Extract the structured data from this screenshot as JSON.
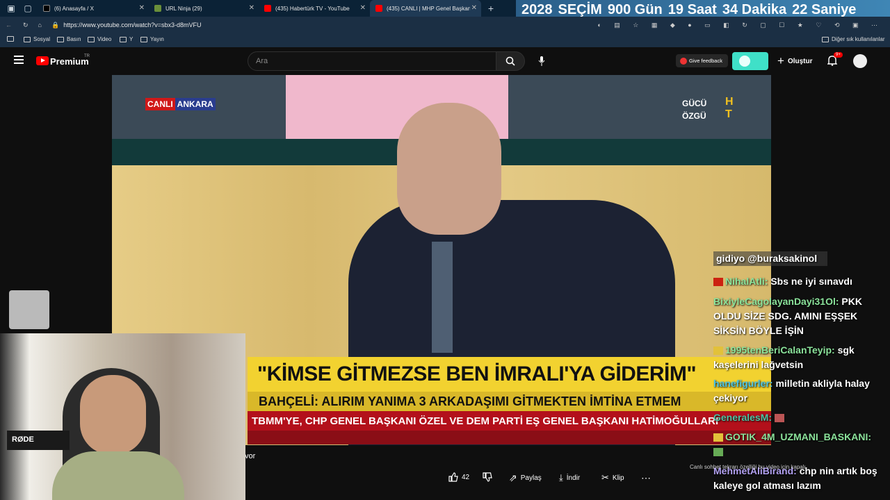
{
  "browser": {
    "tabs": [
      {
        "title": "(6) Anasayfa / X"
      },
      {
        "title": "URL Ninja (29)"
      },
      {
        "title": "(435) Habertürk TV - YouTube"
      },
      {
        "title": "(435) CANLI | MHP Genel Başkan..."
      }
    ],
    "url": "https://www.youtube.com/watch?v=sbx3-d8mVFU",
    "bookmarks": [
      "Sosyal",
      "Basın",
      "Video",
      "Y",
      "Yayın"
    ],
    "other_bookmarks": "Diğer sık kullanılanlar"
  },
  "countdown": {
    "parts": [
      "2028",
      "SEÇİM",
      "900 Gün",
      "19 Saat",
      "34 Dakika",
      "22 Saniye"
    ]
  },
  "youtube": {
    "logo_text": "Premium",
    "logo_sup": "TR",
    "search_placeholder": "Ara",
    "feedback_label": "Give feedback",
    "create_label": "Oluştur",
    "notification_count": "9+"
  },
  "video": {
    "live_label": "CANLI",
    "city_label": "ANKARA",
    "corner_logo_1": "GÜCÜ",
    "corner_logo_2": "ÖZGÜ",
    "corner_logo_ht": "HT",
    "headline": "\"KİMSE GİTMEZSE BEN İMRALI'YA GİDERİM\"",
    "subline": "BAHÇELİ: ALIRIM YANIMA 3 ARKADAŞIMI GİTMEKTEN İMTİNA ETMEM",
    "ticker": "TBMM'YE, CHP GENEL BAŞKANI ÖZEL VE DEM PARTİ EŞ GENEL BAŞKANI HATİMOĞULLARI",
    "overlay_fragment": "vor"
  },
  "actions": {
    "like_count": "42",
    "share": "Paylaş",
    "download": "İndir",
    "clip": "Klip",
    "notice": "Canlı sohbet tekrarı özelliği bu video için kapalı"
  },
  "chat": [
    {
      "user": "",
      "text": "gidiyo @buraksakinol"
    },
    {
      "user": "NihalAtli:",
      "text": "Sbs ne iyi sınavdı"
    },
    {
      "user": "BixiyleCagolayanDayi31Ol:",
      "text": "PKK OLDU SİZE SDG. AMINI EŞŞEK SİKSİN BÖYLE İŞİN"
    },
    {
      "user": "1995tenBeriCalanTeyip:",
      "text": "sgk kaşelerini lağvetsin"
    },
    {
      "user": "hanefigurler:",
      "text": "milletin akliyla halay çekiyor"
    },
    {
      "user": "GeneralesM:",
      "text": ""
    },
    {
      "user": "GOTIK_4M_UZMANI_BASKANI:",
      "text": ""
    },
    {
      "user": "MehmetAliBirand:",
      "text": "chp nin artık boş kaleye gol atması lazım"
    }
  ],
  "colors": {
    "accent_red": "#ff0000",
    "tab_bg": "#0b2236",
    "headline_yellow": "#f2d230",
    "ticker_red": "#b3101b",
    "chat_user_green": "#8be39b"
  }
}
